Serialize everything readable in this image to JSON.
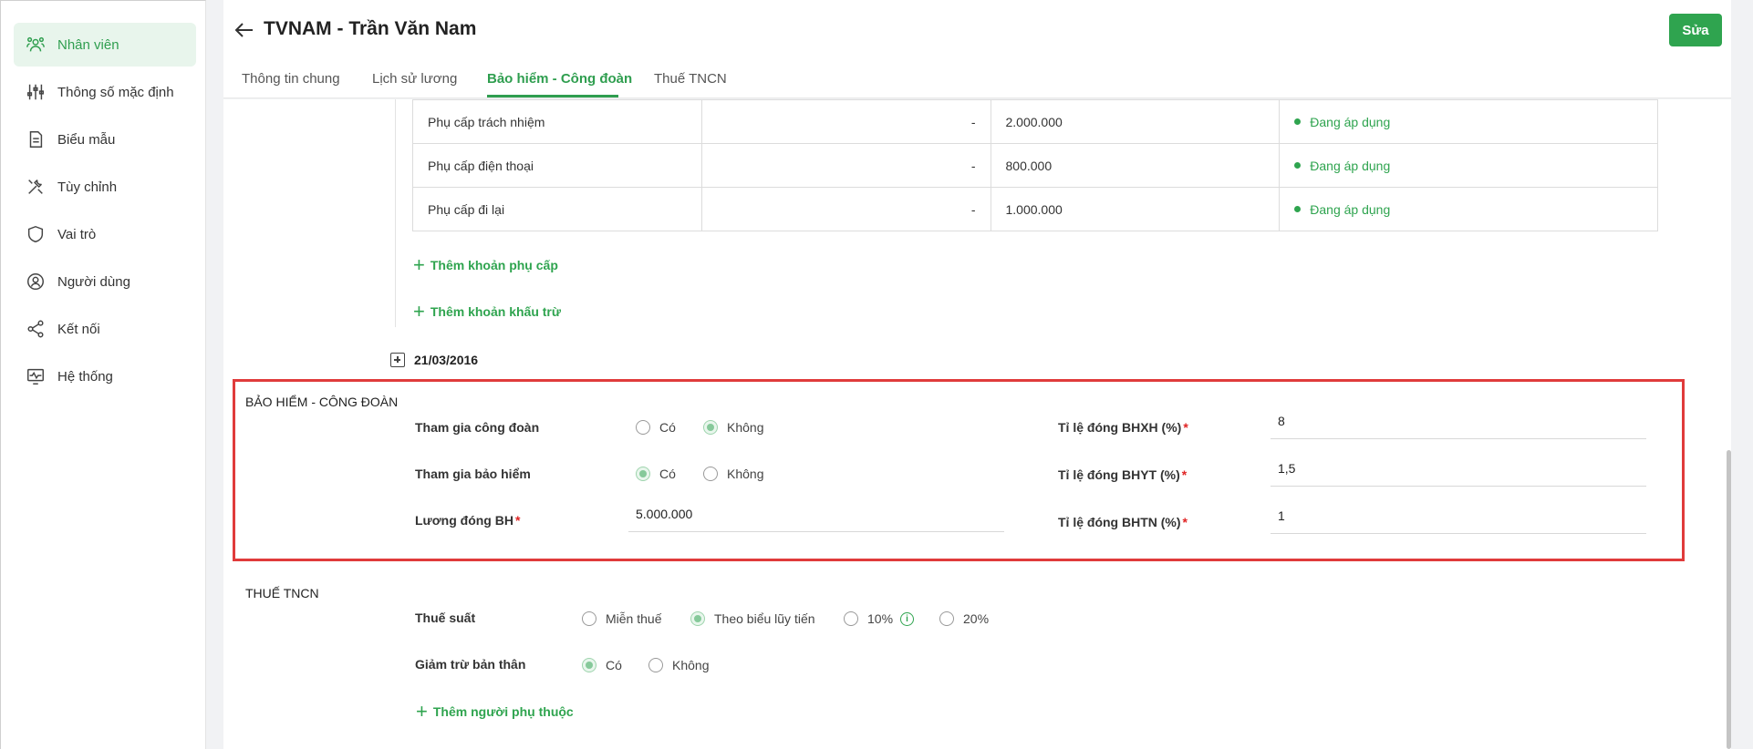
{
  "sidebar": {
    "items": [
      {
        "label": "Nhân viên",
        "icon": "users-icon",
        "active": true
      },
      {
        "label": "Thông số mặc định",
        "icon": "sliders-icon"
      },
      {
        "label": "Biểu mẫu",
        "icon": "document-icon"
      },
      {
        "label": "Tùy chỉnh",
        "icon": "tools-icon"
      },
      {
        "label": "Vai trò",
        "icon": "shield-icon"
      },
      {
        "label": "Người dùng",
        "icon": "user-circle-icon"
      },
      {
        "label": "Kết nối",
        "icon": "share-icon"
      },
      {
        "label": "Hệ thống",
        "icon": "monitor-icon"
      }
    ]
  },
  "header": {
    "title": "TVNAM - Trần Văn Nam",
    "edit_label": "Sửa",
    "tabs": [
      {
        "label": "Thông tin chung"
      },
      {
        "label": "Lịch sử lương"
      },
      {
        "label": "Bảo hiểm - Công đoàn",
        "active": true
      },
      {
        "label": "Thuế TNCN"
      }
    ]
  },
  "allowances": {
    "rows": [
      {
        "name": "Phụ cấp trách nhiệm",
        "col2": "-",
        "amount": "2.000.000",
        "status": "Đang áp dụng"
      },
      {
        "name": "Phụ cấp điện thoại",
        "col2": "-",
        "amount": "800.000",
        "status": "Đang áp dụng"
      },
      {
        "name": "Phụ cấp đi lại",
        "col2": "-",
        "amount": "1.000.000",
        "status": "Đang áp dụng"
      }
    ],
    "add_allowance": "Thêm khoản phụ cấp",
    "add_deduction": "Thêm khoản khấu trừ",
    "date": "21/03/2016"
  },
  "insurance": {
    "title": "BẢO HIỂM - CÔNG ĐOÀN",
    "union_label": "Tham gia công đoàn",
    "insurance_label": "Tham gia bảo hiểm",
    "salary_label": "Lương đóng BH",
    "salary_value": "5.000.000",
    "yes": "Có",
    "no": "Không",
    "union_selected": "Không",
    "insurance_selected": "Có",
    "bhxh_label": "Tỉ lệ đóng BHXH (%)",
    "bhxh_value": "8",
    "bhyt_label": "Tỉ lệ đóng BHYT (%)",
    "bhyt_value": "1,5",
    "bhtn_label": "Tỉ lệ đóng BHTN (%)",
    "bhtn_value": "1",
    "required_mark": "*"
  },
  "tax": {
    "title": "THUẾ TNCN",
    "rate_label": "Thuế suất",
    "rate_options": [
      "Miễn thuế",
      "Theo biểu lũy tiến",
      "10%",
      "20%"
    ],
    "rate_selected": "Theo biểu lũy tiến",
    "info_icon": "info-icon",
    "deduction_label": "Giảm trừ bản thân",
    "deduction_yes": "Có",
    "deduction_no": "Không",
    "deduction_selected": "Có",
    "add_dependent": "Thêm người phụ thuộc"
  },
  "colors": {
    "accent": "#2fa44f",
    "highlight_border": "#e03b3b",
    "required": "#e02424"
  }
}
